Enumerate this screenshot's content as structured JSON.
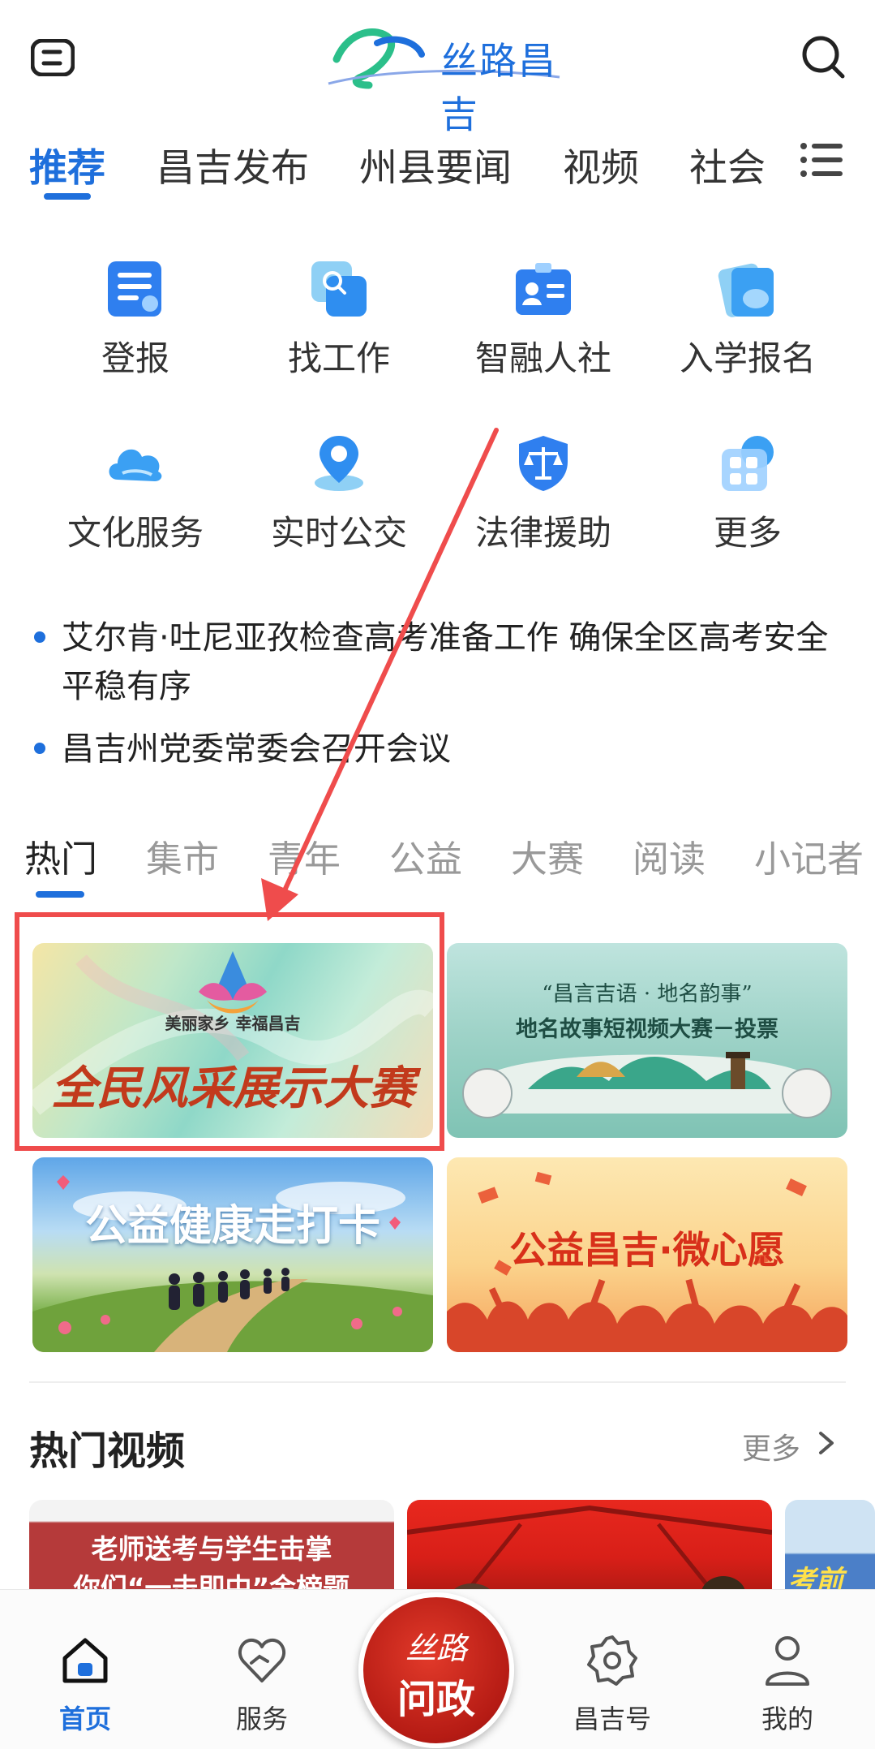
{
  "header": {
    "logo_text": "丝路昌吉",
    "colors": {
      "accent": "#1e6fdc",
      "highlight": "#ef4c4c",
      "cta": "#c8231a"
    }
  },
  "top_tabs": [
    "推荐",
    "昌吉发布",
    "州县要闻",
    "视频",
    "社会"
  ],
  "services": [
    {
      "label": "登报",
      "icon": "newspaper-icon"
    },
    {
      "label": "找工作",
      "icon": "job-search-icon"
    },
    {
      "label": "智融人社",
      "icon": "id-card-icon"
    },
    {
      "label": "入学报名",
      "icon": "enrollment-icon"
    },
    {
      "label": "文化服务",
      "icon": "cloud-icon"
    },
    {
      "label": "实时公交",
      "icon": "location-pin-icon"
    },
    {
      "label": "法律援助",
      "icon": "legal-scale-icon"
    },
    {
      "label": "更多",
      "icon": "grid-more-icon"
    }
  ],
  "headlines": [
    "艾尔肯·吐尼亚孜检查高考准备工作 确保全区高考安全平稳有序",
    "昌吉州党委常委会召开会议"
  ],
  "category_tabs": [
    "热门",
    "集市",
    "青年",
    "公益",
    "大赛",
    "阅读",
    "小记者"
  ],
  "banners": [
    {
      "subtitle": "美丽家乡  幸福昌吉",
      "title": "全民风采展示大赛"
    },
    {
      "subtitle": "“昌言吉语 · 地名韵事”",
      "title": "地名故事短视频大赛－投票"
    },
    {
      "title": "公益健康走打卡"
    },
    {
      "title": "公益昌吉·微心愿"
    }
  ],
  "hot_video": {
    "title": "热门视频",
    "more": "更多",
    "card1_line1": "老师送考与学生击掌",
    "card1_line2": "你们“一击即中”金榜题",
    "card3_text": "考前"
  },
  "bottom_nav": {
    "home": "首页",
    "service": "服务",
    "center_top": "丝路",
    "center_bottom": "问政",
    "changji": "昌吉号",
    "mine": "我的"
  }
}
